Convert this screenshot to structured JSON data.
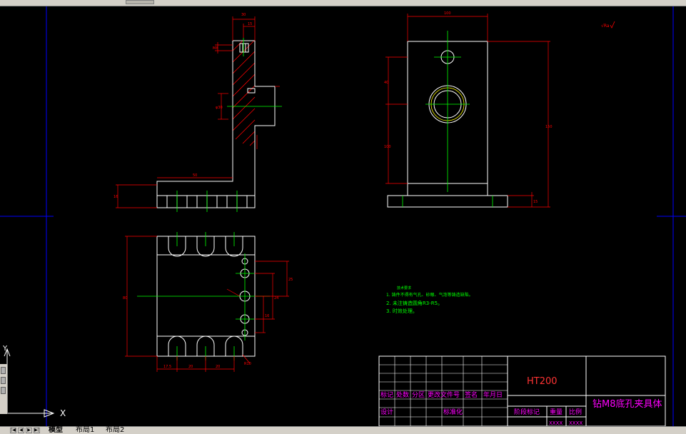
{
  "tabs": [
    {
      "label": "模型",
      "active": true
    },
    {
      "label": "布局1",
      "active": false
    },
    {
      "label": "布局2",
      "active": false
    }
  ],
  "drawing": {
    "material": "HT200",
    "title": "钻M8底孔夹具体",
    "scale_mark": "√Ra",
    "title_block_labels": [
      "标记",
      "处数",
      "分区",
      "更改文件号",
      "签名",
      "年月日",
      "设计",
      "标准化",
      "阶段标记",
      "重量",
      "比例"
    ],
    "title_block_values": [
      "XXXX",
      "XXXX"
    ],
    "tech_req_heading": "技术要求",
    "tech_req": [
      "1. 铸件不得有气孔、砂眼、气泡等铸造缺陷。",
      "2. 未注铸造圆角R3-R5。",
      "3. 时效处理。"
    ],
    "axis_x_label": "X",
    "axis_y_label": "Y"
  },
  "colors": {
    "background": "#000000",
    "outline": "#ffffff",
    "dimension": "#ff0000",
    "centerline": "#00ff00",
    "hatch": "#ff0000",
    "viewport": "#0000ff",
    "title_text": "#ff00ff",
    "material_text": "#ff3333"
  }
}
